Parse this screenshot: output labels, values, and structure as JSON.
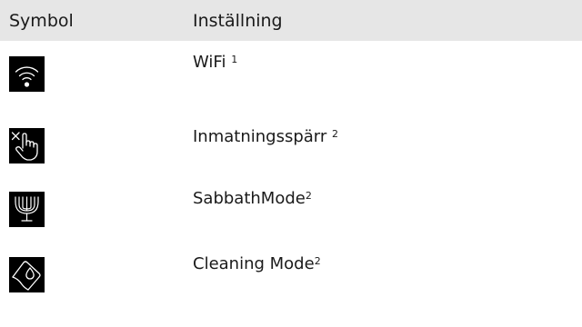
{
  "table": {
    "headers": {
      "symbol": "Symbol",
      "setting": "Inställning"
    },
    "rows": [
      {
        "icon": "wifi-icon",
        "label": "WiFi",
        "footnote": "1",
        "footnote_spaced": true
      },
      {
        "icon": "input-lock-hand-icon",
        "label": "Inmatningsspärr",
        "footnote": "2",
        "footnote_spaced": true
      },
      {
        "icon": "menorah-sabbath-icon",
        "label": "SabbathMode",
        "footnote": "2",
        "footnote_spaced": false
      },
      {
        "icon": "cleaning-mode-icon",
        "label": "Cleaning Mode",
        "footnote": "2",
        "footnote_spaced": false
      }
    ]
  },
  "colors": {
    "header_bg": "#e6e6e6",
    "icon_bg": "#000000",
    "icon_fg": "#ffffff",
    "text": "#1a1a1a"
  }
}
